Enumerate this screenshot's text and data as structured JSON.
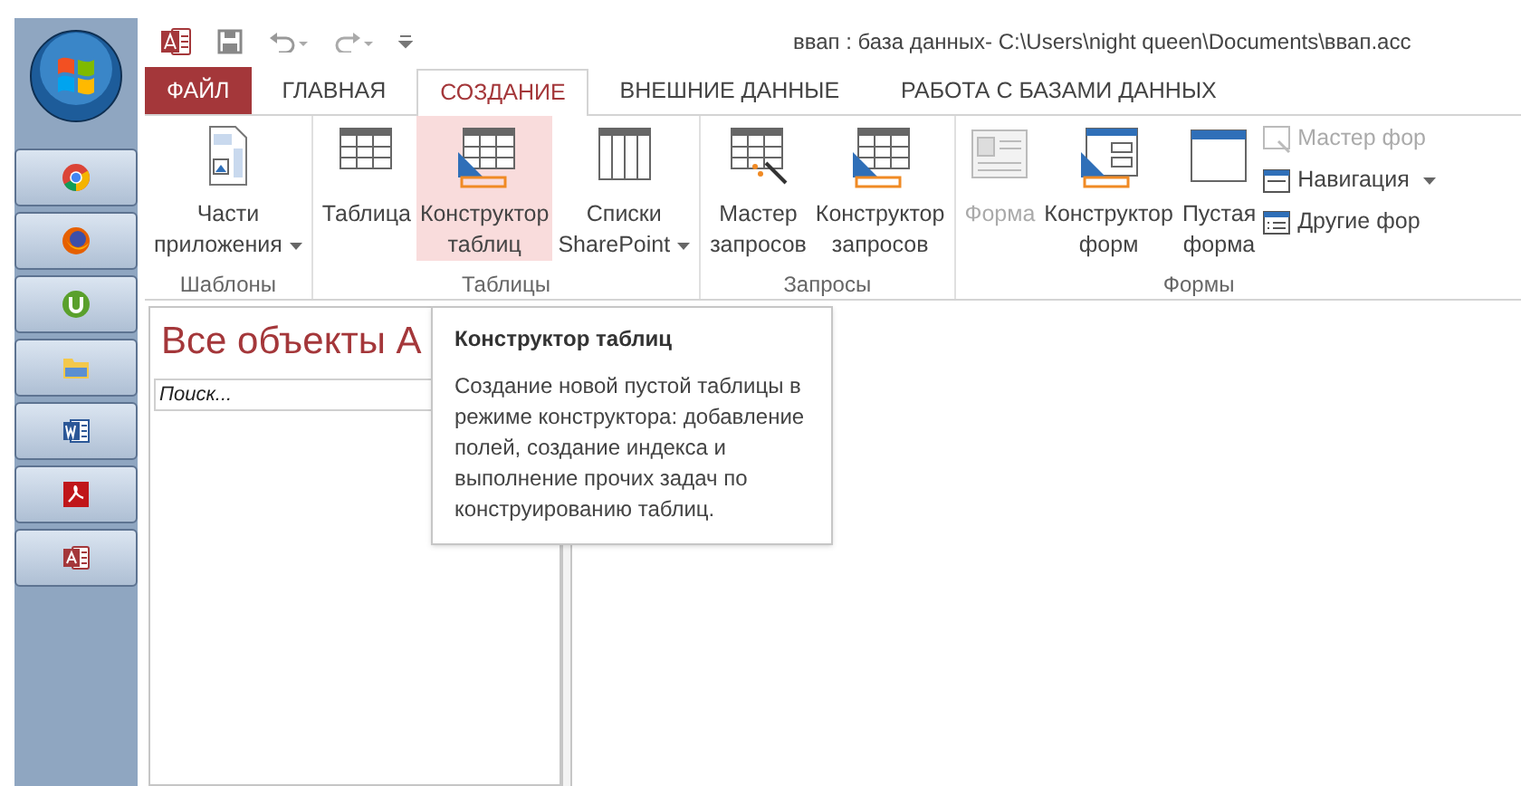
{
  "taskbar": {
    "apps": [
      {
        "kind": "chrome"
      },
      {
        "kind": "firefox"
      },
      {
        "kind": "utorrent"
      },
      {
        "kind": "explorer"
      },
      {
        "kind": "word"
      },
      {
        "kind": "pdf"
      },
      {
        "kind": "access"
      }
    ]
  },
  "window": {
    "title": "ввап : база данных- C:\\Users\\night queen\\Documents\\ввап.acc"
  },
  "tabs": [
    {
      "label": "ФАЙЛ",
      "kind": "file",
      "selected": false
    },
    {
      "label": "ГЛАВНАЯ",
      "kind": "tab",
      "selected": false
    },
    {
      "label": "СОЗДАНИЕ",
      "kind": "tab",
      "selected": true
    },
    {
      "label": "ВНЕШНИЕ ДАННЫЕ",
      "kind": "tab",
      "selected": false
    },
    {
      "label": "РАБОТА С БАЗАМИ ДАННЫХ",
      "kind": "tab",
      "selected": false
    }
  ],
  "ribbon": {
    "groups": [
      {
        "label": "Шаблоны",
        "items": [
          {
            "kind": "large",
            "lines": [
              "Части",
              "приложения"
            ],
            "dropdown": true,
            "disabled": false,
            "highlighted": false
          }
        ]
      },
      {
        "label": "Таблицы",
        "items": [
          {
            "kind": "large",
            "lines": [
              "Таблица"
            ],
            "dropdown": false,
            "disabled": false,
            "highlighted": false
          },
          {
            "kind": "large",
            "lines": [
              "Конструктор",
              "таблиц"
            ],
            "dropdown": false,
            "disabled": false,
            "highlighted": true
          },
          {
            "kind": "large",
            "lines": [
              "Списки",
              "SharePoint"
            ],
            "dropdown": true,
            "disabled": false,
            "highlighted": false
          }
        ]
      },
      {
        "label": "Запросы",
        "items": [
          {
            "kind": "large",
            "lines": [
              "Мастер",
              "запросов"
            ],
            "dropdown": false,
            "disabled": false,
            "highlighted": false
          },
          {
            "kind": "large",
            "lines": [
              "Конструктор",
              "запросов"
            ],
            "dropdown": false,
            "disabled": false,
            "highlighted": false
          }
        ]
      },
      {
        "label": "Формы",
        "items": [
          {
            "kind": "large",
            "lines": [
              "Форма"
            ],
            "dropdown": false,
            "disabled": true,
            "highlighted": false
          },
          {
            "kind": "large",
            "lines": [
              "Конструктор",
              "форм"
            ],
            "dropdown": false,
            "disabled": false,
            "highlighted": false
          },
          {
            "kind": "large",
            "lines": [
              "Пустая",
              "форма"
            ],
            "dropdown": false,
            "disabled": false,
            "highlighted": false
          },
          {
            "kind": "stack",
            "entries": [
              {
                "label": "Мастер фор",
                "dropdown": false,
                "disabled": true
              },
              {
                "label": "Навигация",
                "dropdown": true,
                "disabled": false
              },
              {
                "label": "Другие фор",
                "dropdown": false,
                "disabled": false
              }
            ]
          }
        ]
      }
    ]
  },
  "nav_pane": {
    "title": "Все объекты A",
    "search": {
      "placeholder": "Поиск..."
    }
  },
  "tooltip": {
    "title": "Конструктор таблиц",
    "text": "Создание новой пустой таблицы в режиме конструктора: добавление полей, создание индекса и выполнение прочих задач по конструированию таблиц."
  }
}
